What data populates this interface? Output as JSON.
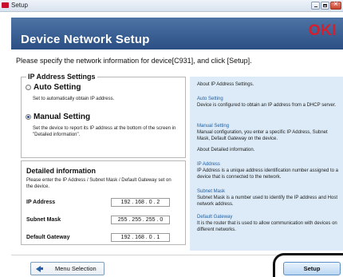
{
  "window": {
    "title": "Setup"
  },
  "header": {
    "title": "Device Network Setup",
    "logo": "OKI"
  },
  "instruction": "Please specify the network information for device[C931], and click [Setup].",
  "ip_settings": {
    "legend": "IP Address Settings",
    "auto": {
      "label": "Auto Setting",
      "desc": "Set to automatically obtain IP address.",
      "checked": false
    },
    "manual": {
      "label": "Manual Setting",
      "desc": "Set the device to report its IP address at the bottom of the screen in \"Detailed information\".",
      "checked": true
    }
  },
  "detail": {
    "title": "Detailed information",
    "desc": "Please enter the IP Address / Subnet Mask / Default Gateway set on the device.",
    "fields": [
      {
        "label": "IP Address",
        "value": "192 . 168 . 0 . 2"
      },
      {
        "label": "Subnet Mask",
        "value": "255 . 255 . 255 . 0"
      },
      {
        "label": "Default Gateway",
        "value": "192 . 168 . 0 . 1"
      }
    ]
  },
  "help": {
    "intro": "About IP Address Settings.",
    "auto_title": "Auto Setting",
    "auto_text": "Device is configured to obtain an IP address from a DHCP server.",
    "manual_title": "Manual Setting",
    "manual_text": "Manual configuration, you enter a specific IP Address, Subnet Mask, Default Gateway on the device.",
    "detail_intro": "About Detailed information.",
    "ip_title": "IP Address",
    "ip_text": "IP Address is a unique address identification number assigned to a device that is connected to the network.",
    "subnet_title": "Subnet Mask",
    "subnet_text": "Subnet Mask is a number used to identify the IP address and Host network address.",
    "gateway_title": "Default Gateway",
    "gateway_text": "It is the router that is used to allow communication with devices on different networks."
  },
  "footer": {
    "menu_label": "Menu Selection",
    "setup_label": "Setup"
  }
}
